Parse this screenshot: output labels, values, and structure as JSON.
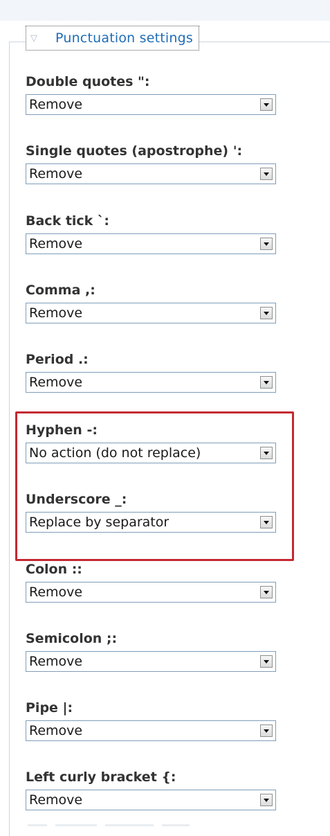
{
  "fieldset": {
    "legend": "Punctuation settings",
    "legend_icon": "triangle-down-icon"
  },
  "fields": [
    {
      "label": "Double quotes \":",
      "value": "Remove"
    },
    {
      "label": "Single quotes (apostrophe) ':",
      "value": "Remove"
    },
    {
      "label": "Back tick `:",
      "value": "Remove"
    },
    {
      "label": "Comma ,:",
      "value": "Remove"
    },
    {
      "label": "Period .:",
      "value": "Remove"
    },
    {
      "label": "Hyphen -:",
      "value": "No action (do not replace)"
    },
    {
      "label": "Underscore _:",
      "value": "Replace by separator"
    },
    {
      "label": "Colon ::",
      "value": "Remove"
    },
    {
      "label": "Semicolon ;:",
      "value": "Remove"
    },
    {
      "label": "Pipe |:",
      "value": "Remove"
    },
    {
      "label": "Left curly bracket {:",
      "value": "Remove"
    }
  ],
  "colors": {
    "highlight": "#c42932",
    "legend_text": "#1f6db6",
    "label_text": "#333333"
  }
}
